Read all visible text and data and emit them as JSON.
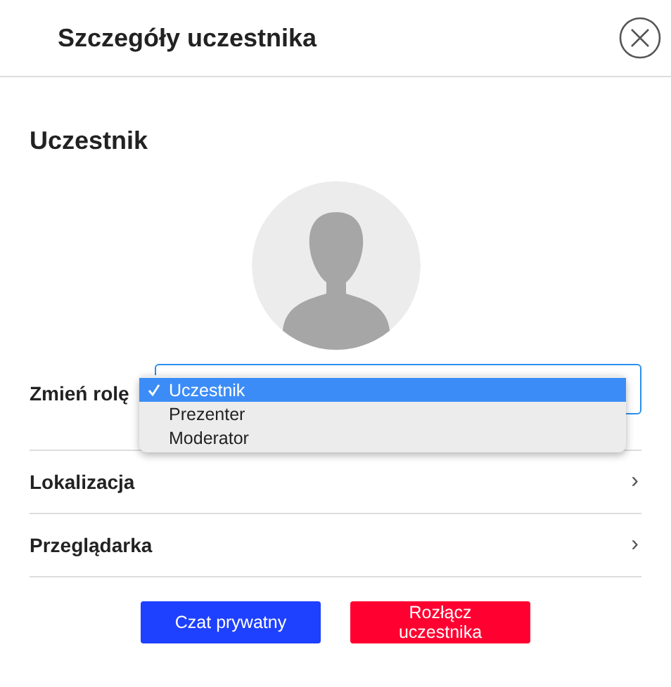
{
  "dialog": {
    "title": "Szczegóły uczestnika"
  },
  "section_title": "Uczestnik",
  "role": {
    "label": "Zmień rolę",
    "options": [
      {
        "label": "Uczestnik",
        "selected": true
      },
      {
        "label": "Prezenter",
        "selected": false
      },
      {
        "label": "Moderator",
        "selected": false
      }
    ]
  },
  "details": [
    {
      "label": "Lokalizacja",
      "chevron": "›"
    },
    {
      "label": "Przeglądarka",
      "chevron": "›"
    }
  ],
  "buttons": [
    {
      "label": "Czat prywatny",
      "kind": "primary"
    },
    {
      "label": "Rozłącz uczestnika",
      "kind": "danger"
    }
  ]
}
